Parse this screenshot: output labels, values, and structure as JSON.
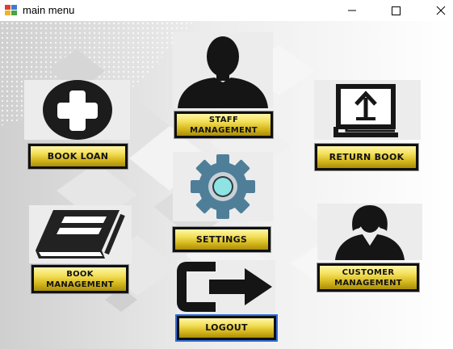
{
  "window": {
    "title": "main menu",
    "controls": {
      "minimize_icon": "minimize-icon",
      "maximize_icon": "maximize-icon",
      "close_icon": "close-icon"
    }
  },
  "menu": {
    "book_loan": {
      "label": "BOOK LOAN",
      "icon": "plus-circle-icon"
    },
    "staff_management": {
      "label_line1": "STAFF",
      "label_line2": "MANAGEMENT",
      "icon": "staff-silhouette-icon"
    },
    "return_book": {
      "label": "RETURN BOOK",
      "icon": "book-return-icon"
    },
    "settings": {
      "label": "SETTINGS",
      "icon": "gear-icon"
    },
    "book_management": {
      "label_line1": "BOOK",
      "label_line2": "MANAGEMENT",
      "icon": "book-icon"
    },
    "customer_management": {
      "label_line1": "CUSTOMER",
      "label_line2": "MANAGEMENT",
      "icon": "customer-silhouette-icon"
    },
    "logout": {
      "label": "LOGOUT",
      "icon": "logout-arrow-icon"
    }
  },
  "colors": {
    "button_gold": "#e6cc2e",
    "button_border": "#101010",
    "focus_border": "#2f6fd6",
    "icon_dark": "#1a1a1a",
    "gear_blue": "#4f7f98"
  }
}
